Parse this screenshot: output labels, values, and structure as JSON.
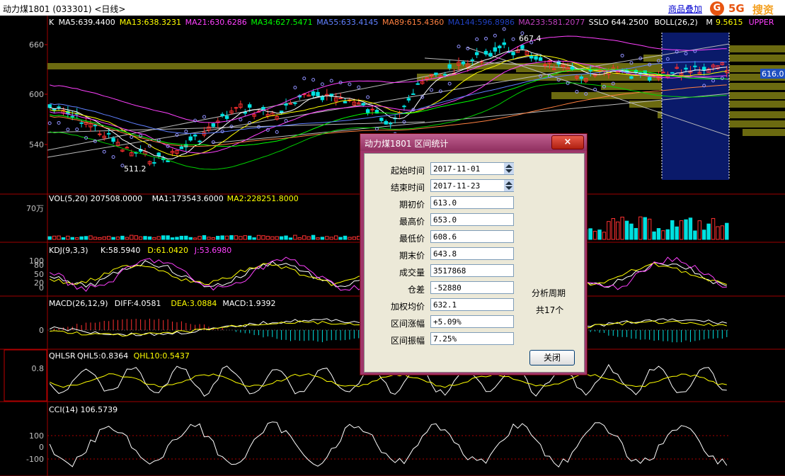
{
  "window": {
    "title": "动力煤1801 (033301) <日线>",
    "overlay_link": "商品叠加"
  },
  "logo": {
    "mark": "G",
    "text1": "5G",
    "text2": "搜资"
  },
  "main_legend": [
    {
      "text": "K",
      "color": "#ffffff"
    },
    {
      "text": "MA5:639.4400",
      "color": "#ffffff"
    },
    {
      "text": "MA13:638.3231",
      "color": "#ffff00"
    },
    {
      "text": "MA21:630.6286",
      "color": "#ff40ff"
    },
    {
      "text": "MA34:627.5471",
      "color": "#00ff00"
    },
    {
      "text": "MA55:633.4145",
      "color": "#6080ff"
    },
    {
      "text": "MA89:615.4360",
      "color": "#ff8040"
    },
    {
      "text": "MA144:596.8986",
      "color": "#2040c0"
    },
    {
      "text": "MA233:581.2077",
      "color": "#c040c0"
    },
    {
      "text": "SSLO 644.2500",
      "color": "#ffffff"
    },
    {
      "text": "BOLL(26,2)",
      "color": "#ffffff"
    },
    {
      "text": "M",
      "color": "#ffffff"
    },
    {
      "text": "9.5615",
      "color": "#ffff00"
    },
    {
      "text": "UPPER",
      "color": "#ff40ff"
    }
  ],
  "price_axis": {
    "ticks": [
      "660",
      "600",
      "540"
    ],
    "current_price": "616.0"
  },
  "annotations": {
    "high": "667.4",
    "low": "511.2"
  },
  "volume_panel": {
    "legend": [
      {
        "text": "VOL(5,20) 207508.0000",
        "color": "#ffffff"
      },
      {
        "text": "MA1:173543.6000",
        "color": "#ffffff"
      },
      {
        "text": "MA2:228251.8000",
        "color": "#ffff00"
      }
    ],
    "axis_label": "70万"
  },
  "kdj_panel": {
    "legend": [
      {
        "text": "KDJ(9,3,3)",
        "color": "#ffffff"
      },
      {
        "text": "K:58.5940",
        "color": "#ffffff"
      },
      {
        "text": "D:61.0420",
        "color": "#ffff00"
      },
      {
        "text": "J:53.6980",
        "color": "#ff40ff"
      }
    ],
    "ticks": [
      "100",
      "80",
      "50",
      "20",
      "0"
    ]
  },
  "macd_panel": {
    "legend": [
      {
        "text": "MACD(26,12,9)",
        "color": "#ffffff"
      },
      {
        "text": "DIFF:4.0581",
        "color": "#ffffff"
      },
      {
        "text": "DEA:3.0884",
        "color": "#ffff00"
      },
      {
        "text": "MACD:1.9392",
        "color": "#ffffff"
      }
    ],
    "ticks": [
      "0"
    ]
  },
  "qhlsr_panel": {
    "legend": [
      {
        "text": "QHLSR",
        "color": "#ffffff"
      },
      {
        "text": "QHL5:0.8364",
        "color": "#ffffff"
      },
      {
        "text": "QHL10:0.5437",
        "color": "#ffff00"
      }
    ],
    "ticks": [
      "0.8"
    ]
  },
  "cci_panel": {
    "legend": [
      {
        "text": "CCI(14) 106.5739",
        "color": "#ffffff"
      }
    ],
    "ticks": [
      "100",
      "0",
      "-100"
    ]
  },
  "dialog": {
    "title": "动力煤1801 区间统计",
    "close_icon": "×",
    "fields": [
      {
        "label": "起始时间",
        "value": "2017-11-01",
        "spinner": true
      },
      {
        "label": "结束时间",
        "value": "2017-11-23",
        "spinner": true
      },
      {
        "label": "期初价",
        "value": "613.0"
      },
      {
        "label": "最高价",
        "value": "653.0"
      },
      {
        "label": "最低价",
        "value": "608.6"
      },
      {
        "label": "期末价",
        "value": "643.8"
      },
      {
        "label": "成交量",
        "value": "3517868"
      },
      {
        "label": "仓差",
        "value": "-52880"
      },
      {
        "label": "加权均价",
        "value": "632.1"
      },
      {
        "label": "区间涨幅",
        "value": "+5.09%"
      },
      {
        "label": "区间振幅",
        "value": "7.25%"
      }
    ],
    "period_label": "分析周期",
    "period_value": "共17个",
    "close_button": "关闭"
  }
}
